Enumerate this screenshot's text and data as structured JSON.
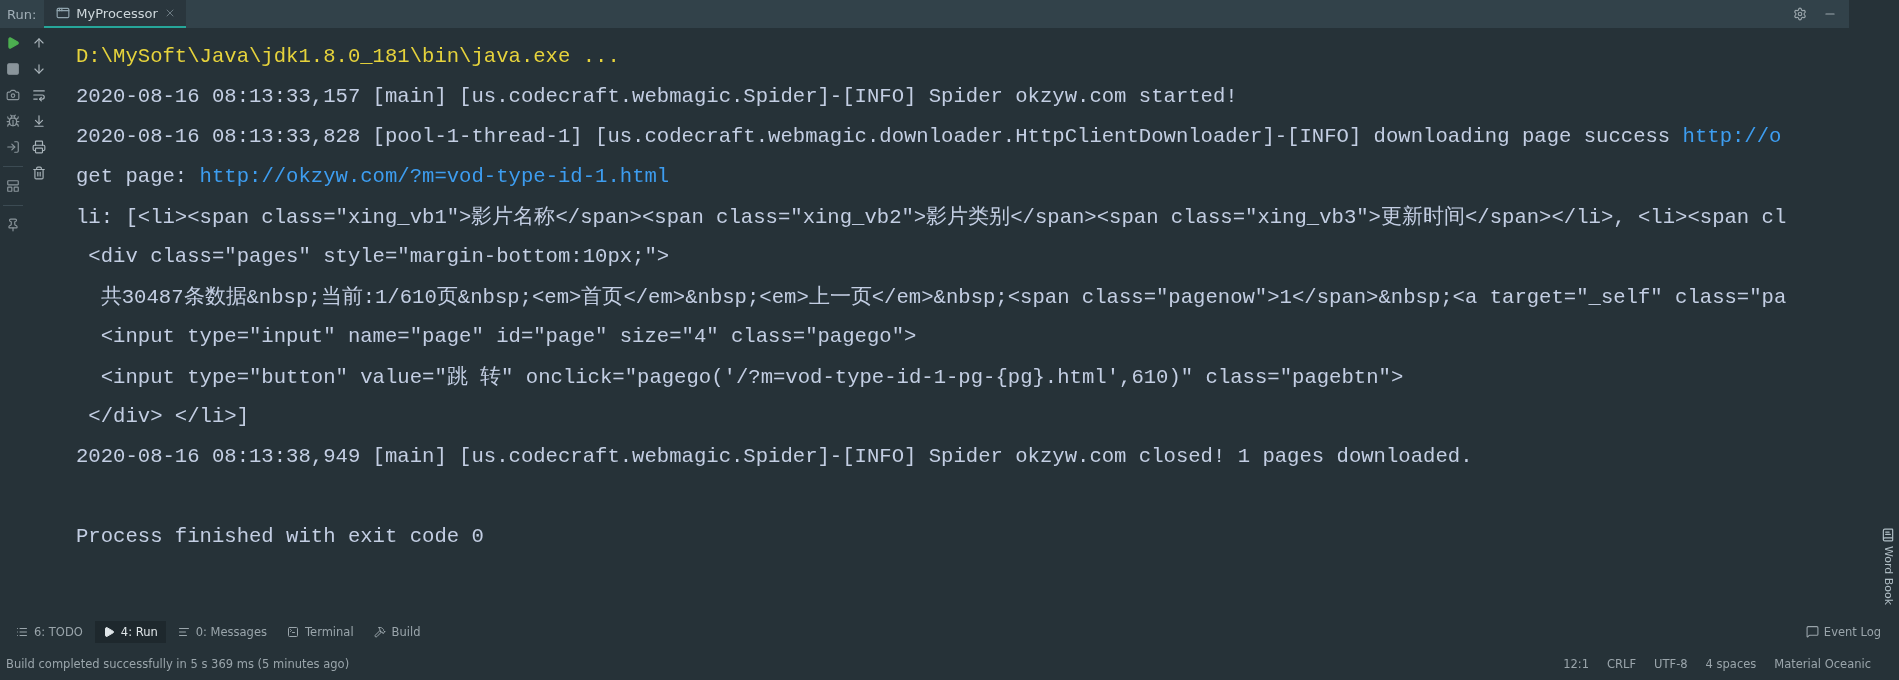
{
  "tool_window": {
    "label": "Run:",
    "tabs": [
      {
        "label": "MyProcessor",
        "selected": true
      }
    ]
  },
  "console": {
    "lines": [
      {
        "segments": [
          {
            "kind": "command",
            "text": "D:\\MySoft\\Java\\jdk1.8.0_181\\bin\\java.exe ..."
          }
        ]
      },
      {
        "segments": [
          {
            "kind": "plain",
            "text": "2020-08-16 08:13:33,157 [main] [us.codecraft.webmagic.Spider]-[INFO] Spider okzyw.com started!"
          }
        ]
      },
      {
        "segments": [
          {
            "kind": "plain",
            "text": "2020-08-16 08:13:33,828 [pool-1-thread-1] [us.codecraft.webmagic.downloader.HttpClientDownloader]-[INFO] downloading page success "
          },
          {
            "kind": "link",
            "text": "http://o"
          }
        ]
      },
      {
        "segments": [
          {
            "kind": "plain",
            "text": "get page: "
          },
          {
            "kind": "link",
            "text": "http://okzyw.com/?m=vod-type-id-1.html"
          }
        ]
      },
      {
        "segments": [
          {
            "kind": "plain",
            "text": "li: [<li><span class=\"xing_vb1\">影片名称</span><span class=\"xing_vb2\">影片类别</span><span class=\"xing_vb3\">更新时间</span></li>, <li><span cl"
          }
        ]
      },
      {
        "segments": [
          {
            "kind": "plain",
            "text": " <div class=\"pages\" style=\"margin-bottom:10px;\">"
          }
        ]
      },
      {
        "segments": [
          {
            "kind": "plain",
            "text": "  共30487条数据&nbsp;当前:1/610页&nbsp;<em>首页</em>&nbsp;<em>上一页</em>&nbsp;<span class=\"pagenow\">1</span>&nbsp;<a target=\"_self\" class=\"pa"
          }
        ]
      },
      {
        "segments": [
          {
            "kind": "plain",
            "text": "  <input type=\"input\" name=\"page\" id=\"page\" size=\"4\" class=\"pagego\">"
          }
        ]
      },
      {
        "segments": [
          {
            "kind": "plain",
            "text": "  <input type=\"button\" value=\"跳 转\" onclick=\"pagego('/?m=vod-type-id-1-pg-{pg}.html',610)\" class=\"pagebtn\">"
          }
        ]
      },
      {
        "segments": [
          {
            "kind": "plain",
            "text": " </div> </li>]"
          }
        ]
      },
      {
        "segments": [
          {
            "kind": "plain",
            "text": "2020-08-16 08:13:38,949 [main] [us.codecraft.webmagic.Spider]-[INFO] Spider okzyw.com closed! 1 pages downloaded."
          }
        ]
      },
      {
        "spaced": true,
        "segments": [
          {
            "kind": "plain",
            "text": "Process finished with exit code 0"
          }
        ]
      }
    ]
  },
  "side_panel": {
    "label": "Word Book"
  },
  "tool_tabs": [
    {
      "kind": "list",
      "label": "6: TODO",
      "selected": false
    },
    {
      "kind": "run",
      "label": "4: Run",
      "selected": true
    },
    {
      "kind": "messages",
      "label": "0: Messages",
      "selected": false
    },
    {
      "kind": "terminal",
      "label": "Terminal",
      "selected": false
    },
    {
      "kind": "build",
      "label": "Build",
      "selected": false
    }
  ],
  "event_log": "Event Log",
  "status_bar": {
    "message": "Build completed successfully in 5 s 369 ms (5 minutes ago)",
    "items": [
      "12:1",
      "CRLF",
      "UTF-8",
      "4 spaces",
      "Material Oceanic"
    ]
  }
}
